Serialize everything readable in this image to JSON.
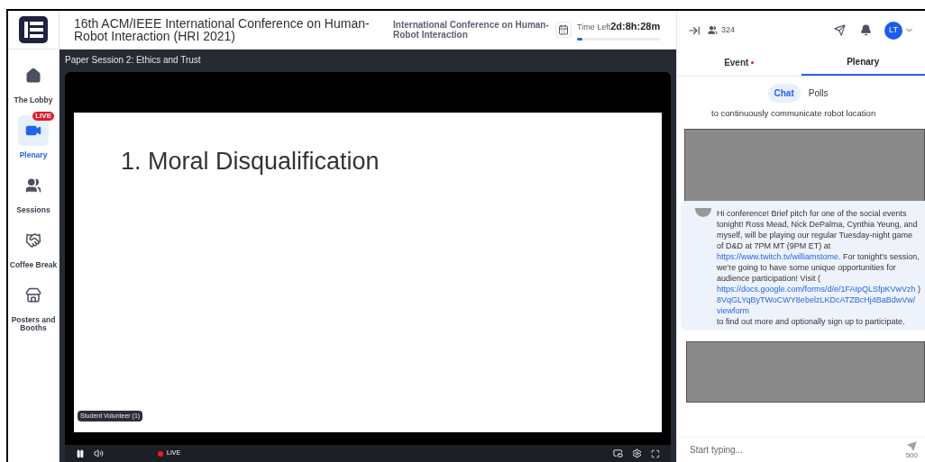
{
  "header": {
    "title": "16th ACM/IEEE International Conference on Human-Robot Interaction (HRI 2021)",
    "event_name": "International Conference on Human-Robot Interaction",
    "time_left_label": "Time Left",
    "time_left": "2d:8h:28m",
    "time_progress": {
      "level": 0.06
    }
  },
  "sidebar": {
    "items": [
      {
        "label": "The Lobby",
        "kind": "home",
        "selected": false
      },
      {
        "label": "Plenary",
        "kind": "video",
        "selected": true,
        "badge": "LIVE"
      },
      {
        "label": "Sessions",
        "kind": "people",
        "selected": false
      },
      {
        "label": "Coffee Break",
        "kind": "handshake",
        "selected": false
      },
      {
        "label": "Posters and Booths",
        "kind": "booth",
        "selected": false
      }
    ]
  },
  "stage": {
    "session_title": "Paper Session 2: Ethics and Trust",
    "slide_title": "1. Moral Disqualification",
    "speaker_tag": "Student Volunteer (1)",
    "live_label": "LIVE"
  },
  "right_panel": {
    "attendees": "324",
    "avatar_initials": "LT",
    "tabs": [
      {
        "label": "Event",
        "selected": false,
        "unread": true
      },
      {
        "label": "Plenary",
        "selected": true,
        "unread": false
      }
    ],
    "subtabs": [
      {
        "label": "Chat",
        "selected": true
      },
      {
        "label": "Polls",
        "selected": false
      }
    ],
    "messages": [
      {
        "kind": "text",
        "text": "to continuously communicate robot location"
      },
      {
        "kind": "redacted"
      },
      {
        "kind": "bubble",
        "parts": [
          {
            "text": "Hi conference! Brief pitch for one of the social events tonight! Ross Mead, Nick DePalma, Cynthia Yeung, and myself, will be playing our regular Tuesday-night game of D&D at 7PM MT (9PM ET) at "
          },
          {
            "text": "https://www.twitch.tv/williamstome",
            "kind": "link"
          },
          {
            "text": ". For tonight's session, we're going to have some unique opportunities for audience participation! Visit ("
          },
          {
            "text": "https://docs.google.com/forms/d/e/1FAIpQLSfpKVwVzh8VqGLYqByTWoCWY8ebelzLKDcATZBcHj4BaBdwVw/viewform",
            "kind": "link"
          },
          {
            "text": ") to find out more and optionally sign up to participate."
          }
        ]
      },
      {
        "kind": "redacted"
      }
    ],
    "composer": {
      "placeholder": "Start typing...",
      "limit": "500"
    }
  }
}
